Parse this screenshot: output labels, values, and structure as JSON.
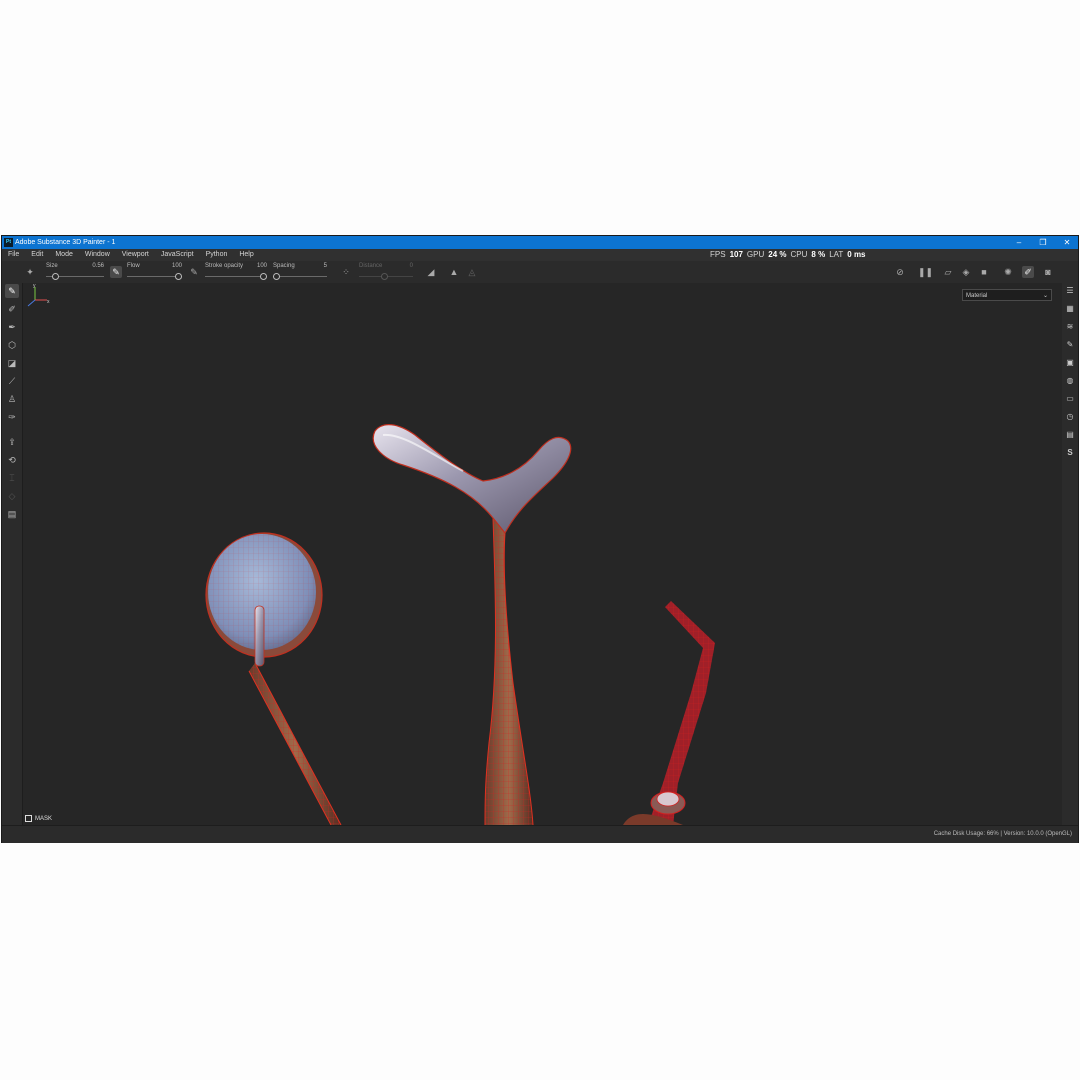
{
  "window": {
    "app_icon": "Pt",
    "title": "Adobe Substance 3D Painter - 1",
    "minimize": "–",
    "restore": "❐",
    "close": "✕"
  },
  "menu": {
    "items": [
      "File",
      "Edit",
      "Mode",
      "Window",
      "Viewport",
      "JavaScript",
      "Python",
      "Help"
    ]
  },
  "stats": {
    "fps_label": "FPS",
    "fps_value": "107",
    "gpu_label": "GPU",
    "gpu_value": "24 %",
    "cpu_label": "CPU",
    "cpu_value": "8 %",
    "lat_label": "LAT",
    "lat_value": "0 ms"
  },
  "tool_options": {
    "size_label": "Size",
    "size_value": "0.56",
    "size_level": 0.12,
    "flow_label": "Flow",
    "flow_value": "100",
    "flow_level": 1.0,
    "opacity_label": "Stroke opacity",
    "opacity_value": "100",
    "opacity_level": 1.0,
    "spacing_label": "Spacing",
    "spacing_value": "5",
    "spacing_level": 0.0,
    "distance_label": "Distance",
    "distance_value": "0"
  },
  "viewport": {
    "material_select": "Material",
    "mask_label": "MASK",
    "axis_y": "y",
    "axis_x": "x"
  },
  "status": {
    "text": "Cache Disk Usage:   66% | Version: 10.0.0 (OpenGL)"
  },
  "colors": {
    "title_bar": "#0d74d1",
    "viewport_bg": "#262626",
    "wireframe": "#d42020"
  }
}
